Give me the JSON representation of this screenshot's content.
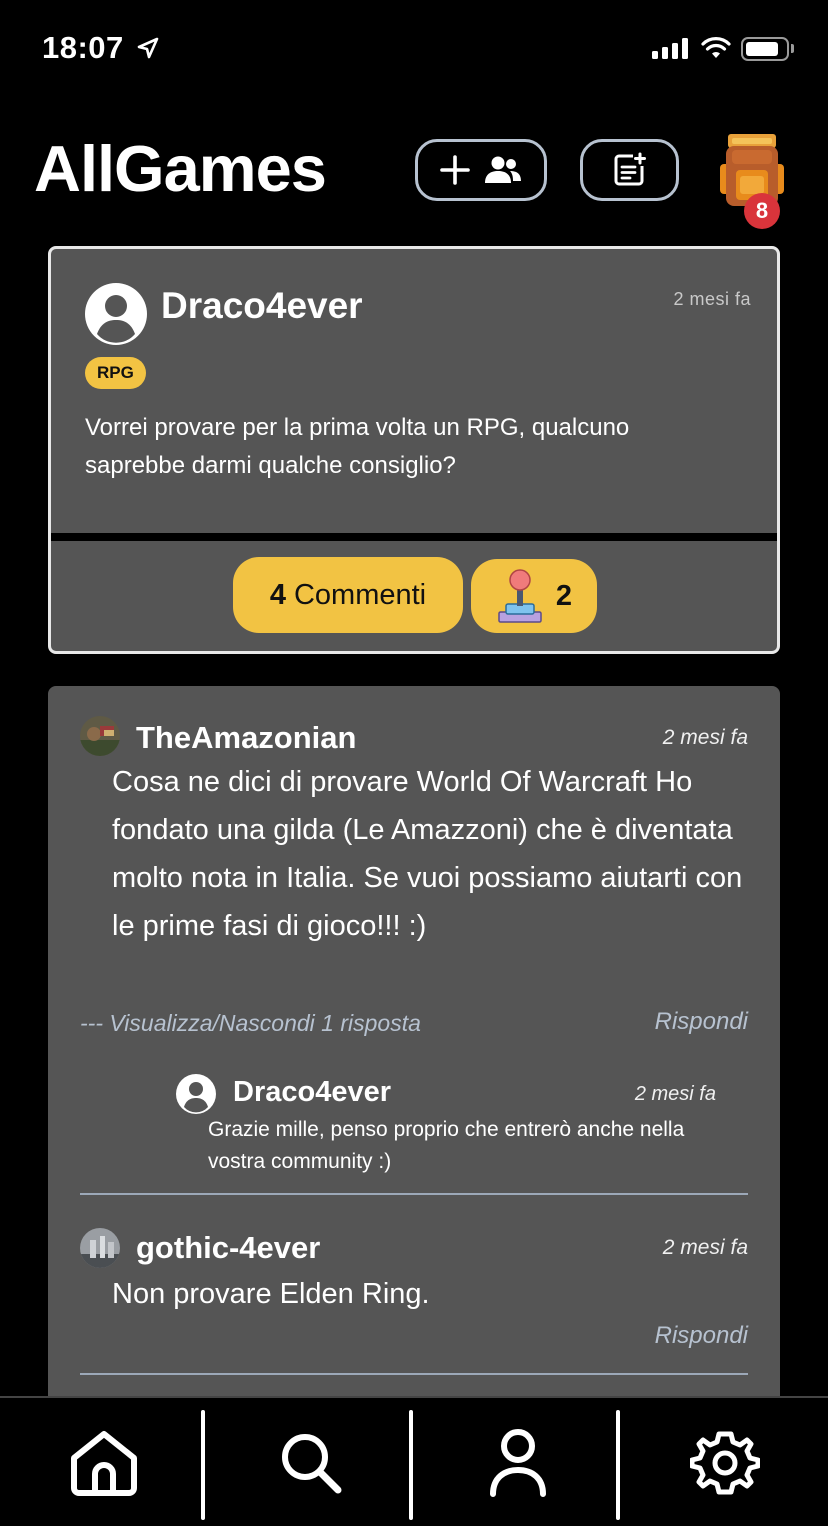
{
  "status_bar": {
    "time": "18:07"
  },
  "header": {
    "title": "AllGames",
    "notification_count": "8"
  },
  "post": {
    "author": "Draco4ever",
    "time": "2 mesi fa",
    "tag": "RPG",
    "text": "Vorrei provare per la prima volta un RPG, qualcuno saprebbe darmi qualche consiglio?",
    "comments_count": "4",
    "comments_label": "Commenti",
    "likes_count": "2"
  },
  "comments": [
    {
      "author": "TheAmazonian",
      "time": "2 mesi fa",
      "text": "Cosa ne dici di provare World Of Warcraft Ho fondato una gilda (Le Amazzoni) che è diventata molto nota in Italia. Se vuoi possiamo aiutarti con le prime fasi di gioco!!! :)",
      "toggle_label": "--- Visualizza/Nascondi 1 risposta",
      "reply_label": "Rispondi",
      "replies": [
        {
          "author": "Draco4ever",
          "time": "2 mesi fa",
          "text": "Grazie mille, penso proprio che entrerò anche nella vostra community :)"
        }
      ]
    },
    {
      "author": "gothic-4ever",
      "time": "2 mesi fa",
      "text": "Non provare Elden Ring.",
      "reply_label": "Rispondi"
    }
  ],
  "tabs": [
    {
      "icon": "home-icon"
    },
    {
      "icon": "search-icon"
    },
    {
      "icon": "profile-icon"
    },
    {
      "icon": "settings-icon"
    }
  ],
  "colors": {
    "accent": "#f2c343",
    "card": "#555555",
    "badge": "#d9343b",
    "muted": "#b7c2d0"
  }
}
